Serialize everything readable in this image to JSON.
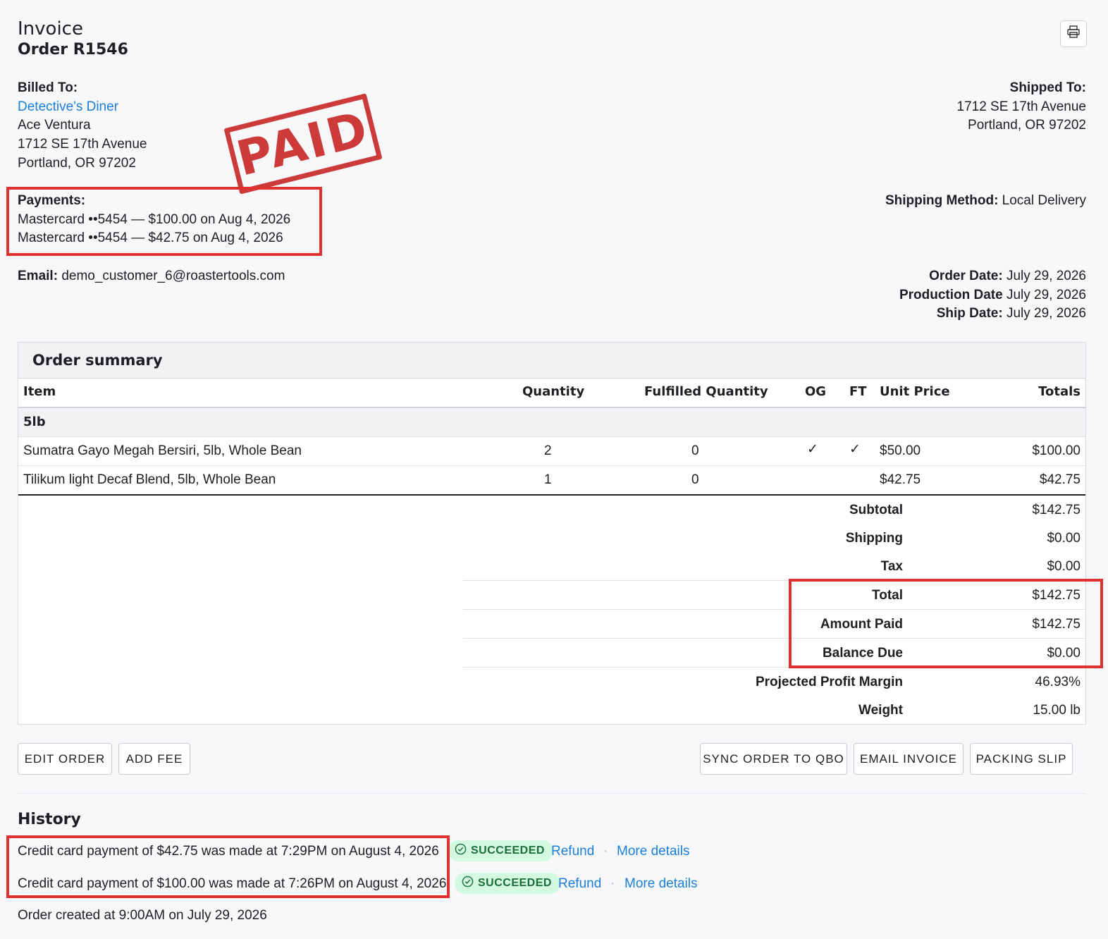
{
  "header": {
    "title": "Invoice",
    "order": "Order R1546"
  },
  "billing": {
    "label": "Billed To:",
    "company": "Detective's Diner",
    "name": "Ace Ventura",
    "street": "1712 SE 17th Avenue",
    "city": "Portland, OR 97202"
  },
  "shipping": {
    "label": "Shipped To:",
    "street": "1712 SE 17th Avenue",
    "city": "Portland, OR 97202",
    "method_label": "Shipping Method:",
    "method": "Local Delivery"
  },
  "stamp": {
    "text": "PAID",
    "color": "#c92a2a"
  },
  "payments": {
    "label": "Payments:",
    "items": [
      "Mastercard ••5454 — $100.00 on Aug 4, 2026",
      "Mastercard ••5454 — $42.75 on Aug 4, 2026"
    ]
  },
  "email": {
    "label": "Email:",
    "value": "demo_customer_6@roastertools.com"
  },
  "dates": {
    "order_label": "Order Date:",
    "order": "July 29, 2026",
    "production_label": "Production Date",
    "production": "July 29, 2026",
    "ship_label": "Ship Date:",
    "ship": "July 29, 2026"
  },
  "summary": {
    "title": "Order summary",
    "columns": [
      "Item",
      "Quantity",
      "Fulfilled Quantity",
      "OG",
      "FT",
      "Unit Price",
      "Totals"
    ],
    "group": "5lb",
    "rows": [
      {
        "item": "Sumatra Gayo Megah Bersiri, 5lb, Whole Bean",
        "qty": "2",
        "fulfilled": "0",
        "og": "✓",
        "ft": "✓",
        "unit": "$50.00",
        "total": "$100.00"
      },
      {
        "item": "Tilikum light Decaf Blend, 5lb, Whole Bean",
        "qty": "1",
        "fulfilled": "0",
        "og": "",
        "ft": "",
        "unit": "$42.75",
        "total": "$42.75"
      }
    ],
    "totals": [
      {
        "label": "Subtotal",
        "value": "$142.75"
      },
      {
        "label": "Shipping",
        "value": "$0.00"
      },
      {
        "label": "Tax",
        "value": "$0.00"
      },
      {
        "label": "Total",
        "value": "$142.75"
      },
      {
        "label": "Amount Paid",
        "value": "$142.75"
      },
      {
        "label": "Balance Due",
        "value": "$0.00"
      },
      {
        "label": "Projected Profit Margin",
        "value": "46.93%"
      },
      {
        "label": "Weight",
        "value": "15.00 lb"
      }
    ]
  },
  "actions": {
    "edit": "EDIT ORDER",
    "add_fee": "ADD FEE",
    "sync": "SYNC ORDER TO QBO",
    "email": "EMAIL INVOICE",
    "packing": "PACKING SLIP"
  },
  "history": {
    "title": "History",
    "entries": [
      {
        "text": "Credit card payment of $42.75 was made at 7:29PM on August 4, 2026",
        "status": "SUCCEEDED",
        "refund": "Refund",
        "details": "More details"
      },
      {
        "text": "Credit card payment of $100.00 was made at 7:26PM on August 4, 2026",
        "status": "SUCCEEDED",
        "refund": "Refund",
        "details": "More details"
      }
    ],
    "created": "Order created at 9:00AM on July 29, 2026"
  },
  "colors": {
    "accent": "#1c7ed6",
    "highlight": "#e03131",
    "success_bg": "#d3f9e0",
    "success_text": "#1b6e3a"
  }
}
